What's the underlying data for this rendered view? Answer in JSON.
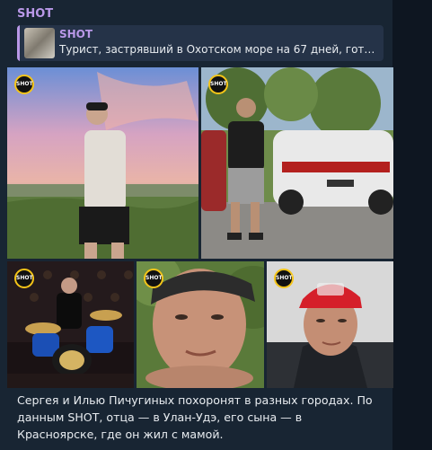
{
  "message": {
    "sender": "SHOT",
    "reply": {
      "title": "SHOT",
      "text": "Турист, застрявший в Охотском море на 67 дней, гото..."
    },
    "photos": [
      {
        "logo": "SHOT"
      },
      {
        "logo": "SHOT"
      },
      {
        "logo": "SHOT"
      },
      {
        "logo": "SHOT"
      },
      {
        "logo": "SHOT"
      }
    ],
    "caption": "Сергея и Илью Пичугиных похоронят в разных городах. По данным SHOT, отца — в Улан-Удэ, его сына — в Красноярске, где он жил с мамой."
  },
  "colors": {
    "background": "#0e1621",
    "bubble": "#182533",
    "accent": "#b998e8",
    "text": "#e8ecf0"
  }
}
